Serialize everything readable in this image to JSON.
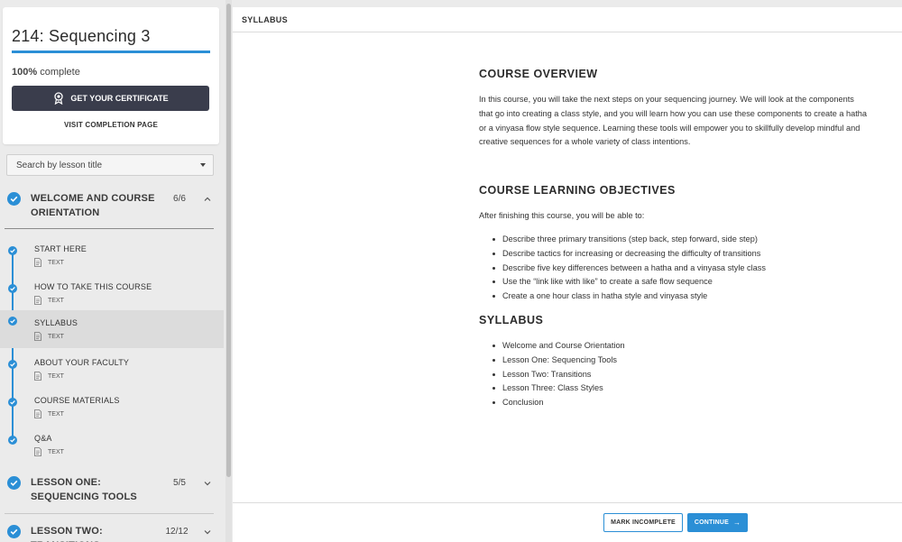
{
  "course": {
    "title": "214: Sequencing 3",
    "progress_percent": 100,
    "progress_pct_text": "100%",
    "progress_suffix": "complete",
    "certificate_button": "GET YOUR CERTIFICATE",
    "completion_link": "VISIT COMPLETION PAGE"
  },
  "search": {
    "label": "Search by lesson title"
  },
  "sections": [
    {
      "title": "WELCOME AND COURSE ORIENTATION",
      "count": "6/6",
      "expanded": true,
      "lessons": [
        {
          "title": "START HERE",
          "type": "TEXT"
        },
        {
          "title": "HOW TO TAKE THIS COURSE",
          "type": "TEXT"
        },
        {
          "title": "SYLLABUS",
          "type": "TEXT",
          "active": true
        },
        {
          "title": "ABOUT YOUR FACULTY",
          "type": "TEXT"
        },
        {
          "title": "COURSE MATERIALS",
          "type": "TEXT"
        },
        {
          "title": "Q&A",
          "type": "TEXT"
        }
      ]
    },
    {
      "title": "LESSON ONE: SEQUENCING TOOLS",
      "count": "5/5",
      "expanded": false
    },
    {
      "title": "LESSON TWO: TRANSITIONS",
      "count": "12/12",
      "expanded": false
    }
  ],
  "main": {
    "header_title": "SYLLABUS",
    "overview_heading": "COURSE OVERVIEW",
    "overview_text": "In this course, you will take the next steps on your sequencing journey. We will look at the components that go into creating a class style, and you will learn how you can use these components to create a hatha or a vinyasa flow style sequence. Learning these tools will empower you to skillfully develop mindful and creative sequences for a whole variety of class intentions.",
    "objectives_heading": "COURSE LEARNING OBJECTIVES",
    "objectives_intro": "After finishing this course, you will be able to:",
    "objectives": [
      "Describe three primary transitions (step back, step forward, side step)",
      "Describe tactics for increasing or decreasing the difficulty of transitions",
      "Describe five key differences between a hatha and a vinyasa style class",
      "Use the “link like with like” to create a safe flow sequence",
      "Create a one hour class in hatha style and vinyasa style"
    ],
    "syllabus_heading": "SYLLABUS",
    "syllabus_items": [
      "Welcome and Course Orientation",
      "Lesson One: Sequencing Tools",
      "Lesson Two: Transitions",
      "Lesson Three: Class Styles",
      "Conclusion"
    ]
  },
  "footer": {
    "mark_incomplete": "MARK INCOMPLETE",
    "continue": "CONTINUE",
    "continue_arrow": "→"
  },
  "colors": {
    "accent": "#2b8fd6",
    "certificate_bg": "#3a3d4c",
    "active_row": "#dcdcdc"
  }
}
